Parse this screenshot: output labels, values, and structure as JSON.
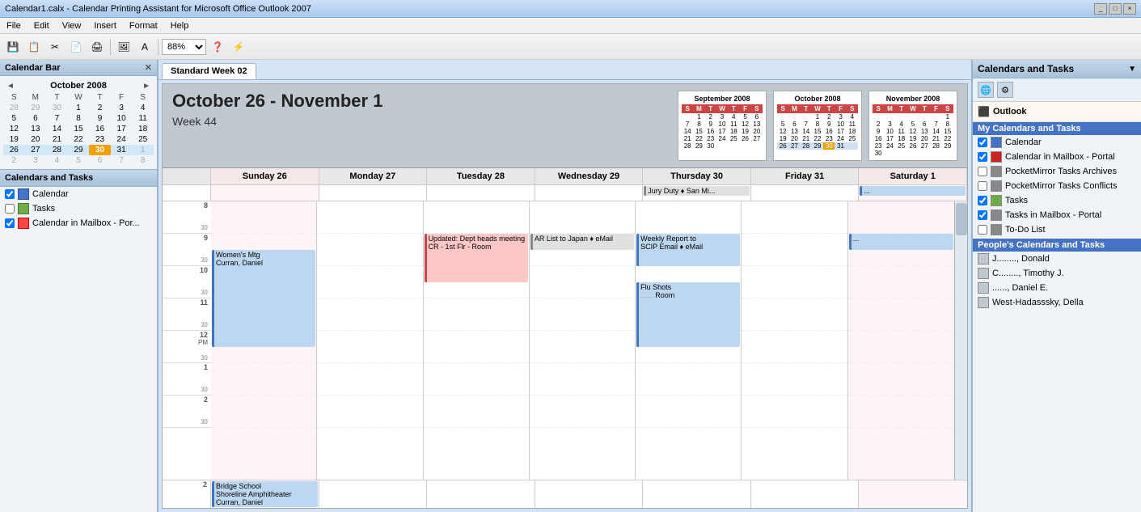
{
  "titleBar": {
    "text": "Calendar1.calx - Calendar Printing Assistant for Microsoft Office Outlook 2007",
    "buttons": [
      "_",
      "□",
      "×"
    ]
  },
  "menuBar": {
    "items": [
      "File",
      "Edit",
      "View",
      "Insert",
      "Format",
      "Help"
    ]
  },
  "toolbar": {
    "zoom": "88%",
    "buttons": [
      "💾",
      "📋",
      "✂",
      "📄",
      "🖨",
      "🔍"
    ]
  },
  "leftPanel": {
    "title": "Calendar Bar",
    "miniCal": {
      "month": "October 2008",
      "headers": [
        "S",
        "M",
        "T",
        "W",
        "T",
        "F",
        "S"
      ],
      "weeks": [
        [
          {
            "day": "28",
            "other": true
          },
          {
            "day": "29",
            "other": true
          },
          {
            "day": "30",
            "other": true
          },
          {
            "day": "1"
          },
          {
            "day": "2"
          },
          {
            "day": "3"
          },
          {
            "day": "4"
          }
        ],
        [
          {
            "day": "5"
          },
          {
            "day": "6"
          },
          {
            "day": "7"
          },
          {
            "day": "8"
          },
          {
            "day": "9"
          },
          {
            "day": "10"
          },
          {
            "day": "11"
          }
        ],
        [
          {
            "day": "12"
          },
          {
            "day": "13"
          },
          {
            "day": "14"
          },
          {
            "day": "15"
          },
          {
            "day": "16"
          },
          {
            "day": "17"
          },
          {
            "day": "18"
          }
        ],
        [
          {
            "day": "19"
          },
          {
            "day": "20"
          },
          {
            "day": "21"
          },
          {
            "day": "22"
          },
          {
            "day": "23"
          },
          {
            "day": "24"
          },
          {
            "day": "25"
          }
        ],
        [
          {
            "day": "26",
            "selected": true
          },
          {
            "day": "27",
            "selected": true
          },
          {
            "day": "28",
            "selected": true
          },
          {
            "day": "29",
            "selected": true
          },
          {
            "day": "30",
            "today": true,
            "selected": true
          },
          {
            "day": "31",
            "selected": true
          },
          {
            "day": "1",
            "other": true,
            "selected": true
          }
        ],
        [
          {
            "day": "2",
            "other": true
          },
          {
            "day": "3",
            "other": true
          },
          {
            "day": "4",
            "other": true
          },
          {
            "day": "5",
            "other": true
          },
          {
            "day": "6",
            "other": true
          },
          {
            "day": "7",
            "other": true
          },
          {
            "day": "8",
            "other": true
          }
        ]
      ]
    },
    "calendarsSection": {
      "title": "Calendars and Tasks",
      "items": [
        {
          "label": "Calendar",
          "checked": true,
          "type": "blue"
        },
        {
          "label": "Tasks",
          "checked": false,
          "type": "green"
        },
        {
          "label": "Calendar in Mailbox - Por...",
          "checked": true,
          "type": "red"
        }
      ]
    }
  },
  "tab": "Standard Week 02",
  "calendarHeader": {
    "title": "October 26 - November 1",
    "subtitle": "Week 44",
    "miniCals": [
      {
        "title": "September 2008",
        "headers": [
          "S",
          "M",
          "T",
          "W",
          "T",
          "F",
          "S"
        ],
        "weeks": [
          [
            "",
            "1",
            "2",
            "3",
            "4",
            "5",
            "6"
          ],
          [
            "7",
            "8",
            "9",
            "10",
            "11",
            "12",
            "13"
          ],
          [
            "14",
            "15",
            "16",
            "17",
            "18",
            "19",
            "20"
          ],
          [
            "21",
            "22",
            "23",
            "24",
            "25",
            "26",
            "27"
          ],
          [
            "28",
            "29",
            "30",
            "",
            "",
            "",
            ""
          ]
        ]
      },
      {
        "title": "October 2008",
        "headers": [
          "S",
          "M",
          "T",
          "W",
          "T",
          "F",
          "S"
        ],
        "weeks": [
          [
            "",
            "",
            "",
            "1",
            "2",
            "3",
            "4"
          ],
          [
            "5",
            "6",
            "7",
            "8",
            "9",
            "10",
            "11"
          ],
          [
            "12",
            "13",
            "14",
            "15",
            "16",
            "17",
            "18"
          ],
          [
            "19",
            "20",
            "21",
            "22",
            "23",
            "24",
            "25"
          ],
          [
            "26",
            "27",
            "28",
            "29",
            "30",
            "31",
            ""
          ],
          [
            "",
            "",
            "",
            "",
            "",
            "",
            ""
          ]
        ],
        "selectedWeek": 4
      },
      {
        "title": "November 2008",
        "headers": [
          "S",
          "M",
          "T",
          "W",
          "T",
          "F",
          "S"
        ],
        "weeks": [
          [
            "",
            "",
            "",
            "",
            "",
            "",
            "1"
          ],
          [
            "2",
            "3",
            "4",
            "5",
            "6",
            "7",
            "8"
          ],
          [
            "9",
            "10",
            "11",
            "12",
            "13",
            "14",
            "15"
          ],
          [
            "16",
            "17",
            "18",
            "19",
            "20",
            "21",
            "22"
          ],
          [
            "23",
            "24",
            "25",
            "26",
            "27",
            "28",
            "29"
          ],
          [
            "30",
            "",
            "",
            "",
            "",
            "",
            ""
          ]
        ]
      }
    ]
  },
  "dayColumns": [
    {
      "label": "Sunday 26",
      "weekend": true
    },
    {
      "label": "Monday 27",
      "weekend": false
    },
    {
      "label": "Tuesday 28",
      "weekend": false
    },
    {
      "label": "Wednesday 29",
      "weekend": false
    },
    {
      "label": "Thursday 30",
      "weekend": false
    },
    {
      "label": "Friday 31",
      "weekend": false
    },
    {
      "label": "Saturday 1",
      "weekend": true
    }
  ],
  "allDayEvents": [
    {
      "col": 4,
      "text": "Jury Duty ♦ San Mi...",
      "color": "gray"
    },
    {
      "col": 6,
      "text": "...",
      "color": "blue"
    }
  ],
  "timeSlots": [
    {
      "hour": "8",
      "label": "8"
    },
    {
      "hour": "9",
      "label": "9"
    },
    {
      "hour": "10",
      "label": "10"
    },
    {
      "hour": "11",
      "label": "11"
    },
    {
      "hour": "12",
      "label": "12 PM"
    },
    {
      "hour": "1",
      "label": "1"
    },
    {
      "hour": "2",
      "label": "2"
    }
  ],
  "events": [
    {
      "col": 0,
      "startHour": 9.5,
      "duration": 3.0,
      "label": "Women's Mtg\nCurran, Daniel",
      "color": "blue"
    },
    {
      "col": 2,
      "startHour": 9.0,
      "duration": 1.5,
      "label": "Updated: Dept heads meeting\nCR - 1st Flr - Room",
      "color": "red"
    },
    {
      "col": 3,
      "startHour": 9.0,
      "duration": 0.5,
      "label": "AR List to Japan ♦ eMail",
      "color": "gray"
    },
    {
      "col": 4,
      "startHour": 9.0,
      "duration": 1.0,
      "label": "Weekly Report to\nSCIP Email ♦ eMail",
      "color": "blue"
    },
    {
      "col": 4,
      "startHour": 10.5,
      "duration": 2.0,
      "label": "Flu Shots\nRoom",
      "color": "blue"
    },
    {
      "col": 6,
      "startHour": 9.0,
      "duration": 0.5,
      "label": "...",
      "color": "blue"
    }
  ],
  "rightPanel": {
    "title": "Calendars and Tasks",
    "outlook": {
      "label": "Outlook",
      "myCalsHeader": "My Calendars and Tasks",
      "items": [
        {
          "label": "Calendar",
          "type": "blue",
          "checked": true
        },
        {
          "label": "Calendar in Mailbox - Portal",
          "type": "red",
          "checked": true
        },
        {
          "label": "PocketMirror Tasks Archives",
          "type": "gray",
          "checked": false
        },
        {
          "label": "PocketMirror Tasks Conflicts",
          "type": "gray",
          "checked": false
        },
        {
          "label": "Tasks",
          "type": "green",
          "checked": true
        },
        {
          "label": "Tasks in Mailbox - Portal",
          "type": "gray",
          "checked": true
        },
        {
          "label": "To-Do List",
          "type": "gray",
          "checked": false
        }
      ],
      "peopleCalsHeader": "People's Calendars and Tasks",
      "people": [
        {
          "label": "J........, Donald"
        },
        {
          "label": "C........, Timothy J."
        },
        {
          "label": "......, Daniel E."
        },
        {
          "label": "West-Hadasssky, Della"
        }
      ]
    }
  }
}
